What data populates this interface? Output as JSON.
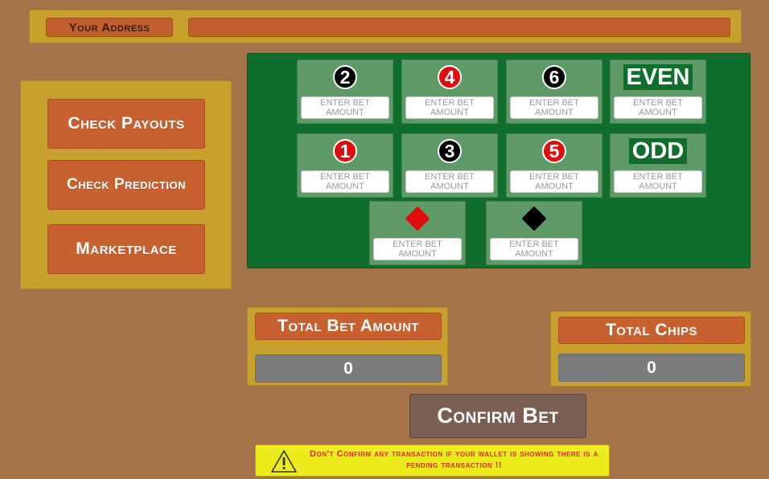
{
  "header": {
    "address_label": "Your Address",
    "address_value": ""
  },
  "menu": {
    "check_payouts": "Check Payouts",
    "check_prediction": "Check Prediction",
    "marketplace": "Marketplace"
  },
  "bets": {
    "placeholder": "ENTER BET\nAMOUNT",
    "items": [
      {
        "id": "2",
        "label": "2",
        "kind": "number",
        "color": "black"
      },
      {
        "id": "4",
        "label": "4",
        "kind": "number",
        "color": "red"
      },
      {
        "id": "6",
        "label": "6",
        "kind": "number",
        "color": "black"
      },
      {
        "id": "even",
        "label": "EVEN",
        "kind": "word"
      },
      {
        "id": "1",
        "label": "1",
        "kind": "number",
        "color": "red"
      },
      {
        "id": "3",
        "label": "3",
        "kind": "number",
        "color": "black"
      },
      {
        "id": "5",
        "label": "5",
        "kind": "number",
        "color": "red"
      },
      {
        "id": "odd",
        "label": "ODD",
        "kind": "word"
      },
      {
        "id": "red",
        "label": "",
        "kind": "diamond",
        "color": "red",
        "icon": "red-diamond-icon"
      },
      {
        "id": "black",
        "label": "",
        "kind": "diamond",
        "color": "black",
        "icon": "black-diamond-icon"
      }
    ]
  },
  "totals": {
    "bet_label": "Total Bet Amount",
    "bet_value": "0",
    "chips_label": "Total Chips",
    "chips_value": "0"
  },
  "confirm_label": "Confirm Bet",
  "warning": {
    "icon": "warning-triangle-icon",
    "text": "Don't Confirm any transaction if your wallet is showing there is a pending transaction !!"
  },
  "colors": {
    "background": "#a5734a",
    "panel": "#c8a02e",
    "button": "#c8612f",
    "table": "#0f6e2b",
    "card": "#5f9a69",
    "red": "#e00d0d",
    "black": "#000000",
    "confirm": "#7b5e52",
    "warning": "#ecec1c",
    "warning_text": "#e2251c"
  }
}
